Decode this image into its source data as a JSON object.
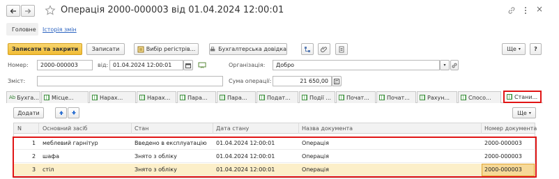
{
  "window": {
    "title": "Операція 2000-000003 від 01.04.2024 12:00:01",
    "back_icon": "arrow-left-icon",
    "forward_icon": "arrow-right-icon",
    "star_icon": "star-outline-icon",
    "link_icon": "link-icon",
    "menu_icon": "more-vertical-icon",
    "close_glyph": "×"
  },
  "nav": {
    "main": "Головне",
    "history": "Історія змін"
  },
  "toolbar": {
    "save_close": "Записати та закрити",
    "save": "Записати",
    "choose_registers": "Вибір регістрів...",
    "accounting_reference": "Бухгалтерська довідка",
    "more": "Ще",
    "help": "?"
  },
  "form": {
    "number_label": "Номер:",
    "number_value": "2000-000003",
    "date_label": "від:",
    "date_value": "01.04.2024 12:00:01",
    "org_label": "Організація:",
    "org_value": "Добро",
    "content_label": "Зміст:",
    "content_value": "",
    "sum_label": "Сума операції:",
    "sum_value": "21 650,00"
  },
  "tabs": [
    "Бухга...",
    "Місце...",
    "Нарах...",
    "Нарах...",
    "Пара...",
    "Пара...",
    "Подат...",
    "Події ...",
    "Почат...",
    "Почат...",
    "Рахун...",
    "Спосо...",
    "Стани..."
  ],
  "table_toolbar": {
    "add": "Додати",
    "more": "Ще"
  },
  "table": {
    "columns": [
      "N",
      "Основний засіб",
      "Стан",
      "Дата стану",
      "Назва документа",
      "Номер документа"
    ],
    "rows": [
      [
        "1",
        "меблевий гарнітур",
        "Введено в експлуатацію",
        "01.04.2024 12:00:01",
        "Операція",
        "2000-000003"
      ],
      [
        "2",
        "шафа",
        "Знято з обліку",
        "01.04.2024 12:00:01",
        "Операція",
        "2000-000003"
      ],
      [
        "3",
        "стіл",
        "Знято з обліку",
        "01.04.2024 12:00:01",
        "Операція",
        "2000-000003"
      ]
    ]
  },
  "colors": {
    "accent_yellow": "#f6c343",
    "selected_row": "#fcefc9",
    "highlight_red": "#e01515",
    "link_blue": "#2b63c0"
  }
}
